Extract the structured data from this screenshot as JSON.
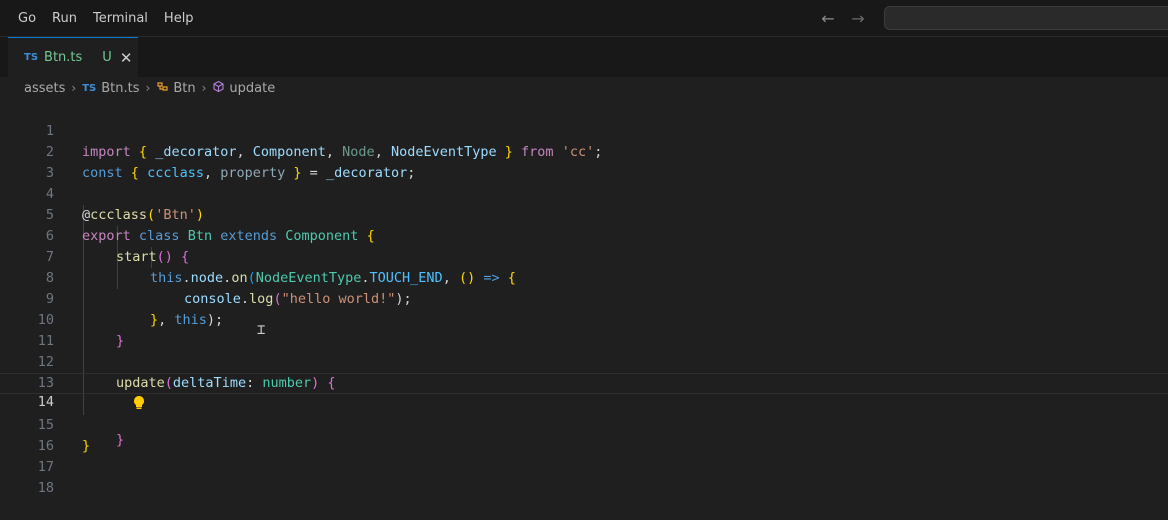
{
  "menu": [
    "Go",
    "Run",
    "Terminal",
    "Help"
  ],
  "tab": {
    "icon_text": "TS",
    "label": "Btn.ts",
    "status": "U",
    "close": "✕"
  },
  "breadcrumb": {
    "folder": "assets",
    "file_icon": "TS",
    "file": "Btn.ts",
    "class": "Btn",
    "method": "update"
  },
  "line_numbers": [
    "1",
    "2",
    "3",
    "4",
    "5",
    "6",
    "7",
    "8",
    "9",
    "10",
    "11",
    "12",
    "13",
    "14",
    "15",
    "16",
    "17",
    "18"
  ],
  "current_line": "14",
  "code": {
    "l1": [
      "import",
      " ",
      "{",
      " ",
      "_decorator",
      ", ",
      "Component",
      ", ",
      "Node",
      ", ",
      "NodeEventType",
      " ",
      "}",
      " ",
      "from",
      " ",
      "'cc'",
      ";"
    ],
    "l2": [
      "const",
      " ",
      "{",
      " ",
      "ccclass",
      ", ",
      "property",
      " ",
      "}",
      " = ",
      "_decorator",
      ";"
    ],
    "l4": [
      "@",
      "ccclass",
      "(",
      "'Btn'",
      ")"
    ],
    "l5": [
      "export",
      " ",
      "class",
      " ",
      "Btn",
      " ",
      "extends",
      " ",
      "Component",
      " ",
      "{"
    ],
    "l6": [
      "start",
      "()",
      " ",
      "{"
    ],
    "l7": [
      "this",
      ".",
      "node",
      ".",
      "on",
      "(",
      "NodeEventType",
      ".",
      "TOUCH_END",
      ", ",
      "()",
      " => ",
      "{"
    ],
    "l8": [
      "console",
      ".",
      "log",
      "(",
      "\"hello world!\"",
      ");"
    ],
    "l9": [
      "}",
      ", ",
      "this",
      ");"
    ],
    "l10": [
      "}"
    ],
    "l12": [
      "update",
      "(",
      "deltaTime",
      ": ",
      "number",
      ")",
      " ",
      "{"
    ],
    "l14": [
      "}"
    ],
    "l15": [
      "}"
    ]
  }
}
